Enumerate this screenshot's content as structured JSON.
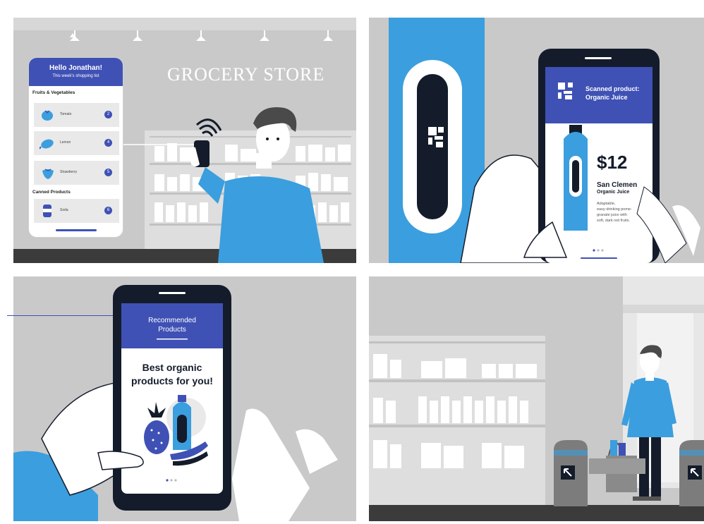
{
  "colors": {
    "brand_blue": "#3f51b5",
    "accent_blue": "#3b9ede",
    "phone_black": "#141c2b",
    "wall_gray": "#c9c9c9",
    "shelf_gray": "#dedede"
  },
  "panel1": {
    "store_sign": "GROCERY STORE",
    "phone": {
      "greeting": "Hello Jonathan!",
      "subtitle": "This week's shopping list",
      "sections": [
        {
          "title": "Fruits & Vegetables",
          "items": [
            {
              "name": "Tomato",
              "qty": "2",
              "icon": "tomato-icon"
            },
            {
              "name": "Lemon",
              "qty": "4",
              "icon": "lemon-icon"
            },
            {
              "name": "Strawberry",
              "qty": "5",
              "icon": "strawberry-icon"
            }
          ]
        },
        {
          "title": "Canned Products",
          "items": [
            {
              "name": "Soda",
              "qty": "6",
              "icon": "soda-can-icon"
            }
          ]
        }
      ]
    }
  },
  "panel2": {
    "header_line1": "Scanned product:",
    "header_line2": "Organic Juice",
    "price": "$12",
    "product_name": "San Clemen",
    "product_type": "Organic Juice",
    "description_lines": [
      "Adaptable,",
      "easy-drinking pome-",
      "granate juice with",
      "soft, dark red fruits."
    ]
  },
  "panel3": {
    "header_line1": "Recommended",
    "header_line2": "Products",
    "headline_line1": "Best organic",
    "headline_line2": "products for you!"
  },
  "panel4": {
    "gate_sign_icon": "exit-arrow-icon"
  }
}
